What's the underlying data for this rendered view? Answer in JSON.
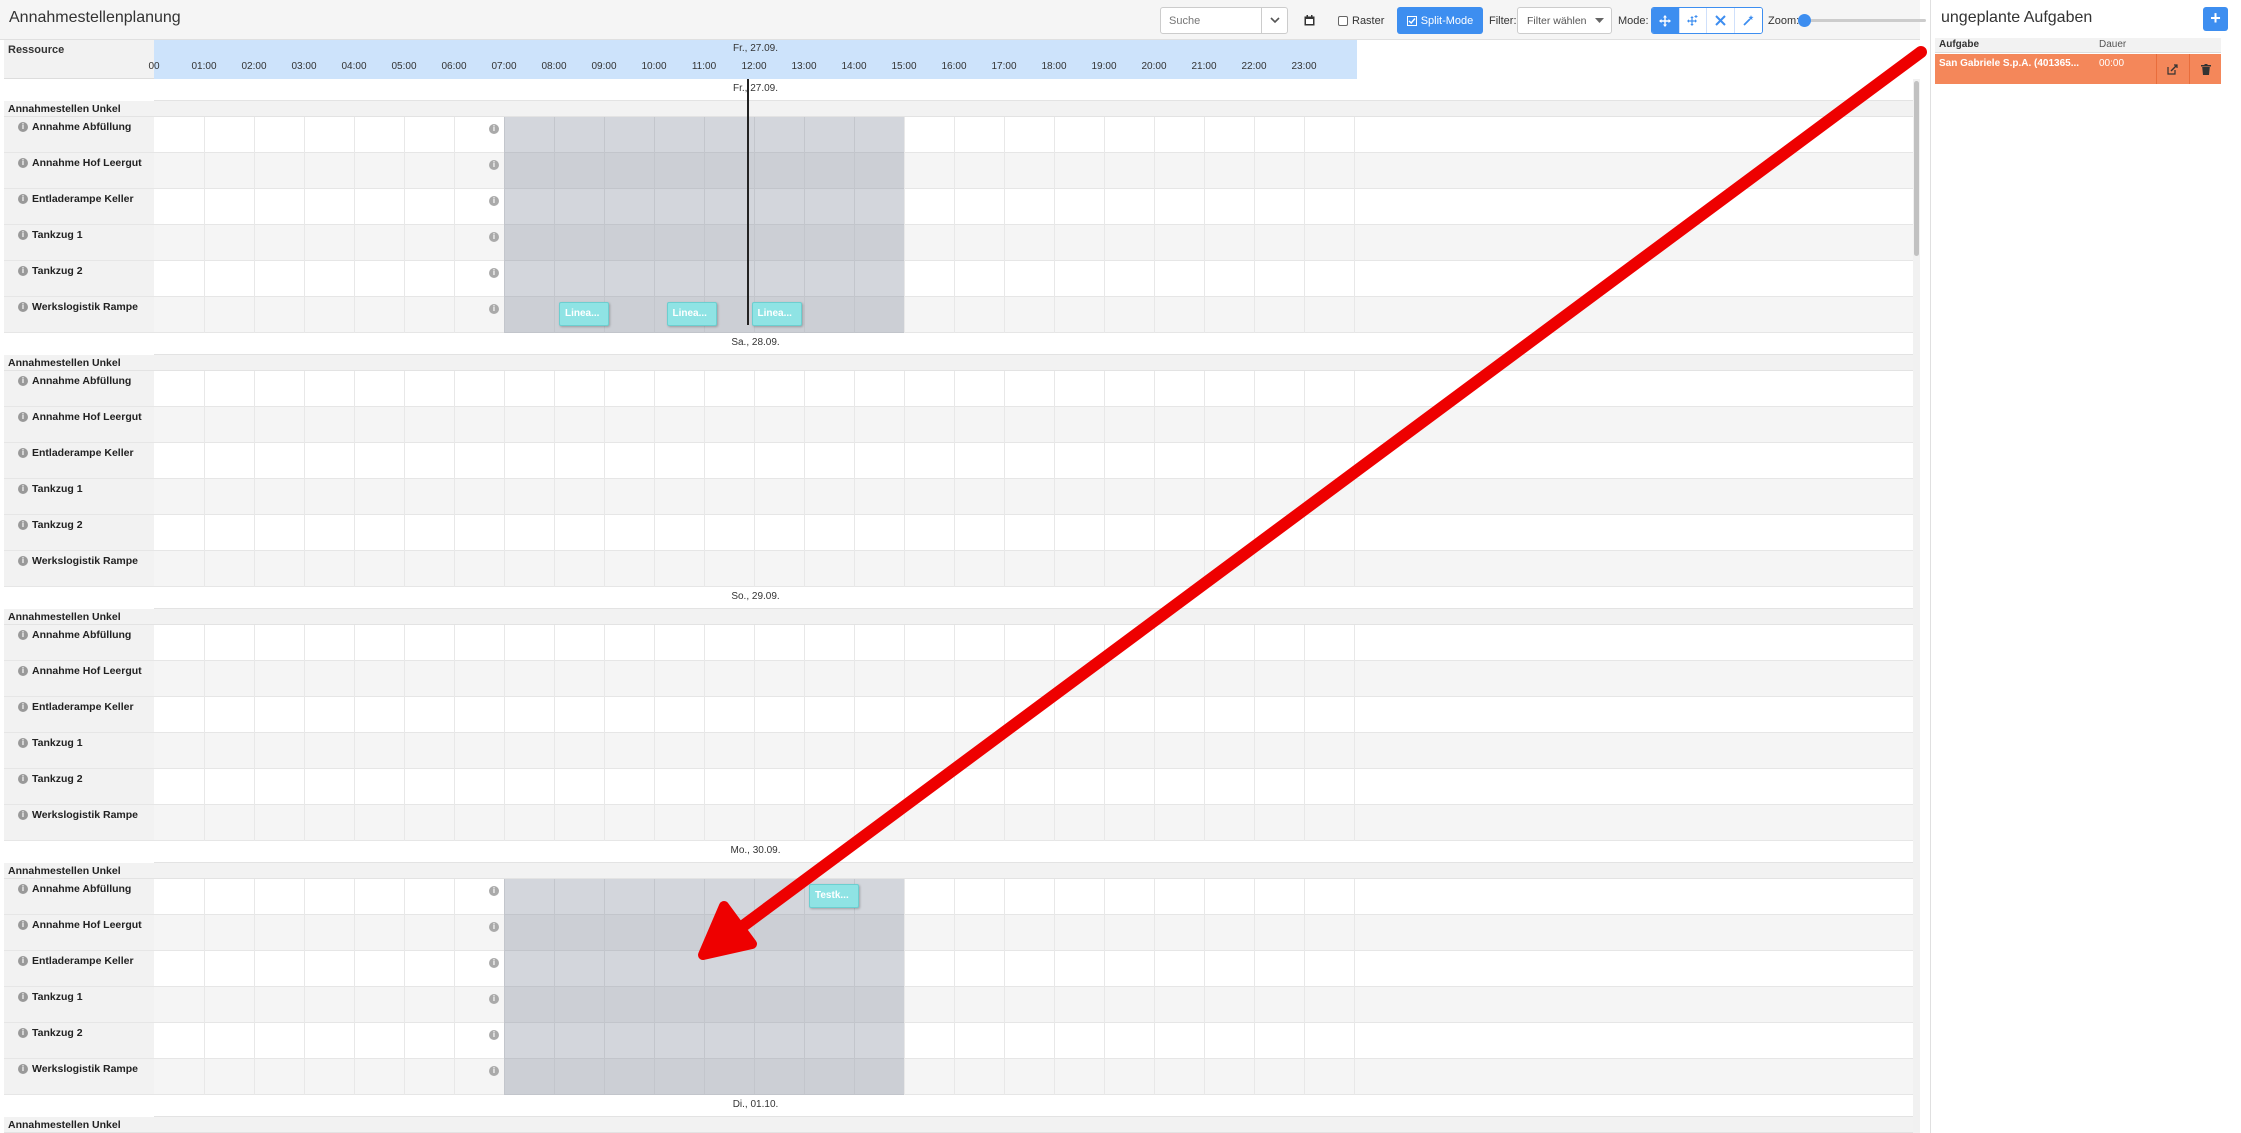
{
  "toolbar": {
    "title": "Annahmestellenplanung",
    "search_placeholder": "Suche",
    "raster_label": "Raster",
    "split_mode_label": "Split-Mode",
    "filter_label": "Filter:",
    "filter_placeholder": "Filter wählen",
    "mode_label": "Mode:",
    "zoom_label": "Zoom:",
    "zoom_value": 0
  },
  "grid": {
    "resource_header": "Ressource",
    "header_date": "Fr., 27.09.",
    "hours": [
      "00",
      "01:00",
      "02:00",
      "03:00",
      "04:00",
      "05:00",
      "06:00",
      "07:00",
      "08:00",
      "09:00",
      "10:00",
      "11:00",
      "12:00",
      "13:00",
      "14:00",
      "15:00",
      "16:00",
      "17:00",
      "18:00",
      "19:00",
      "20:00",
      "21:00",
      "22:00",
      "23:00"
    ],
    "days": [
      {
        "date": "Fr., 27.09.",
        "group": "Annahmestellen Unkel",
        "resources": [
          "Annahme Abfüllung",
          "Annahme Hof Leergut",
          "Entladerampe Keller",
          "Tankzug 1",
          "Tankzug 2",
          "Werkslogistik Rampe"
        ],
        "work_hours": [
          7,
          15
        ],
        "tasks": [
          {
            "resource": 5,
            "start": 8.1,
            "label": "Linea..."
          },
          {
            "resource": 5,
            "start": 10.25,
            "label": "Linea..."
          },
          {
            "resource": 5,
            "start": 11.95,
            "label": "Linea..."
          }
        ]
      },
      {
        "date": "Sa., 28.09.",
        "group": "Annahmestellen Unkel",
        "resources": [
          "Annahme Abfüllung",
          "Annahme Hof Leergut",
          "Entladerampe Keller",
          "Tankzug 1",
          "Tankzug 2",
          "Werkslogistik Rampe"
        ],
        "work_hours": null,
        "tasks": []
      },
      {
        "date": "So., 29.09.",
        "group": "Annahmestellen Unkel",
        "resources": [
          "Annahme Abfüllung",
          "Annahme Hof Leergut",
          "Entladerampe Keller",
          "Tankzug 1",
          "Tankzug 2",
          "Werkslogistik Rampe"
        ],
        "work_hours": null,
        "tasks": []
      },
      {
        "date": "Mo., 30.09.",
        "group": "Annahmestellen Unkel",
        "resources": [
          "Annahme Abfüllung",
          "Annahme Hof Leergut",
          "Entladerampe Keller",
          "Tankzug 1",
          "Tankzug 2",
          "Werkslogistik Rampe"
        ],
        "work_hours": [
          7,
          15
        ],
        "tasks": [
          {
            "resource": 0,
            "start": 13.1,
            "label": "Testk..."
          }
        ]
      },
      {
        "date": "Di., 01.10.",
        "group": "Annahmestellen Unkel",
        "resources": [],
        "work_hours": null,
        "tasks": []
      }
    ],
    "now_hour": 11.85
  },
  "unplanned": {
    "title": "ungeplante Aufgaben",
    "add_label": "+",
    "col_task": "Aufgabe",
    "col_duration": "Dauer",
    "rows": [
      {
        "name": "San Gabriele S.p.A. (401365...",
        "duration": "00:00"
      }
    ]
  },
  "colors": {
    "accent": "#3d8ef0",
    "task": "#8fe3e4",
    "unplanned_row": "#f4875a",
    "arrow": "#ee0000"
  }
}
